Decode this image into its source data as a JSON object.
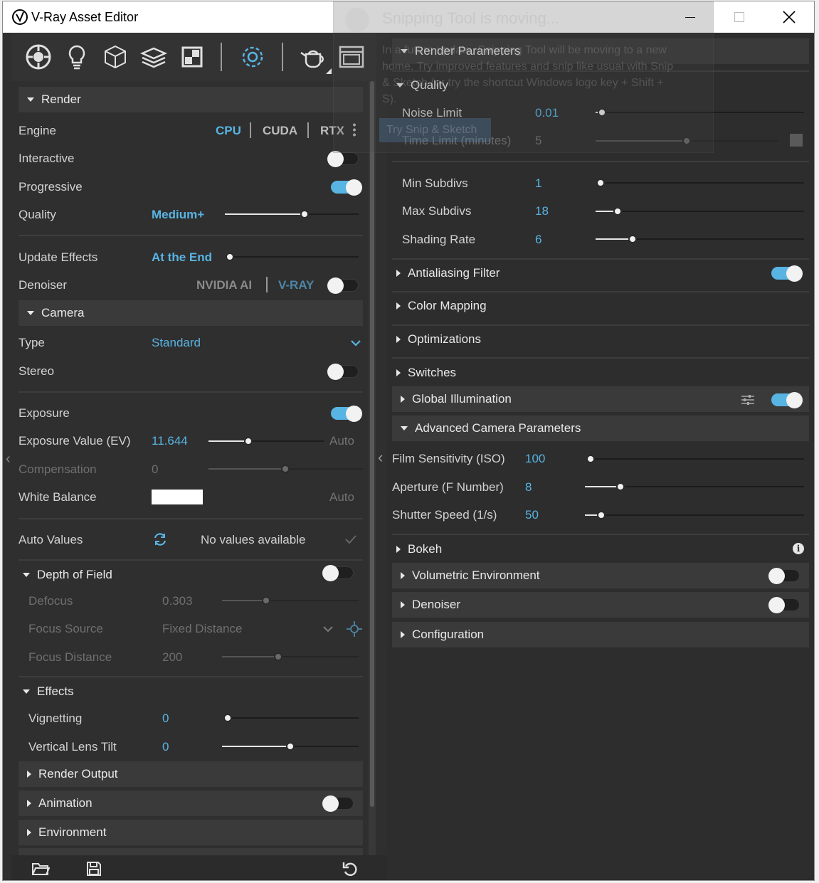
{
  "window": {
    "title": "V-Ray Asset Editor"
  },
  "overlay": {
    "title": "Snipping Tool is moving...",
    "body": "In a future update, Snipping Tool will be moving to a new home. Try improved features and snip like usual with Snip & Sketch (or try the shortcut Windows logo key + Shift + S).",
    "button": "Try Snip & Sketch"
  },
  "left": {
    "render": {
      "title": "Render",
      "engine_label": "Engine",
      "engines": [
        "CPU",
        "CUDA",
        "RTX"
      ],
      "interactive": "Interactive",
      "progressive": "Progressive",
      "quality_label": "Quality",
      "quality_value": "Medium+",
      "quality_level": 0.7,
      "update_effects": "Update Effects",
      "update_value": "At the End",
      "denoiser": "Denoiser",
      "denoiser_opts": [
        "NVIDIA AI",
        "V-RAY"
      ]
    },
    "camera": {
      "title": "Camera",
      "type_label": "Type",
      "type_value": "Standard",
      "stereo": "Stereo",
      "exposure": "Exposure",
      "ev_label": "Exposure Value (EV)",
      "ev_value": "11.644",
      "auto": "Auto",
      "comp_label": "Compensation",
      "comp_value": "0",
      "wb_label": "White Balance",
      "wb_auto": "Auto",
      "auto_values": "Auto Values",
      "no_values": "No values available"
    },
    "dof": {
      "title": "Depth of Field",
      "defocus": "Defocus",
      "defocus_value": "0.303",
      "focus_source": "Focus Source",
      "focus_source_value": "Fixed Distance",
      "focus_distance": "Focus Distance",
      "focus_distance_value": "200"
    },
    "effects": {
      "title": "Effects",
      "vignetting": "Vignetting",
      "vignetting_value": "0",
      "vlt": "Vertical Lens Tilt",
      "vlt_value": "0"
    },
    "collapsed": [
      "Render Output",
      "Animation",
      "Environment"
    ]
  },
  "right": {
    "render_params": "Render Parameters",
    "quality": {
      "title": "Quality",
      "noise": "Noise Limit",
      "noise_value": "0.01",
      "time": "Time Limit (minutes)",
      "time_value": "5",
      "min": "Min Subdivs",
      "min_value": "1",
      "max": "Max Subdivs",
      "max_value": "18",
      "shading": "Shading Rate",
      "shading_value": "6"
    },
    "sections": [
      "Antialiasing Filter",
      "Color Mapping",
      "Optimizations",
      "Switches",
      "Global Illumination"
    ],
    "adv": {
      "title": "Advanced Camera Parameters",
      "iso": "Film Sensitivity (ISO)",
      "iso_value": "100",
      "aperture": "Aperture (F Number)",
      "aperture_value": "8",
      "shutter": "Shutter Speed (1/s)",
      "shutter_value": "50"
    },
    "bottom_sections": [
      "Bokeh",
      "Volumetric Environment",
      "Denoiser",
      "Configuration"
    ]
  }
}
